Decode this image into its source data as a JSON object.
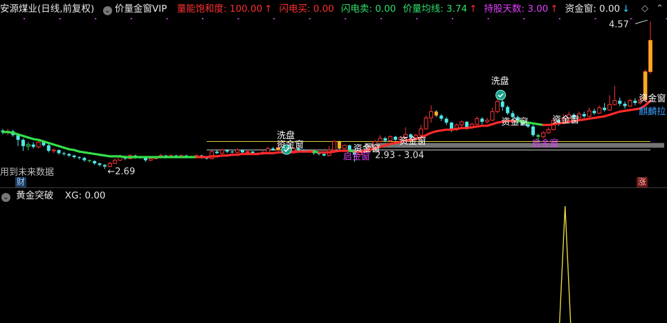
{
  "header": {
    "stock": "安源煤业(日线,前复权)",
    "indicator": "价量金窗VIP",
    "items": [
      {
        "label": "量能饱和度: 100.00",
        "arrow": "↑",
        "color": "#ff3030",
        "arrow_color": "#ff3030"
      },
      {
        "label": "闪电买: 0.00",
        "arrow": "",
        "color": "#ff3030",
        "arrow_color": "#ff3030"
      },
      {
        "label": "闪电卖: 0.00",
        "arrow": "",
        "color": "#2ee06a",
        "arrow_color": "#2ee06a"
      },
      {
        "label": "价量均线: 3.74",
        "arrow": "↑",
        "color": "#2ee06a",
        "arrow_color": "#ff3030"
      },
      {
        "label": "持股天数: 3.00",
        "arrow": "↑",
        "color": "#e040fb",
        "arrow_color": "#ff3030"
      },
      {
        "label": "资金窗: 0.00",
        "arrow": "↓",
        "color": "#e8e8e8",
        "arrow_color": "#39d0ff"
      }
    ],
    "right_icons": [
      "diamond-icon",
      "chevron-up-icon"
    ]
  },
  "sub_header": {
    "indicator": "黄金突破",
    "value": "XG: 0.00"
  },
  "notes": {
    "future_data": "用到未来数据",
    "badge_cai": "财",
    "badge_zhang": "涨"
  },
  "chart_data": [
    {
      "type": "candlestick",
      "annotations": {
        "high_label": "4.57",
        "low_label": "2.69",
        "range_label": "2.93 - 3.04",
        "signals": [
          {
            "text": "洗盘",
            "color": "#ffffff",
            "icon": "shield-check-icon"
          },
          {
            "text": "资金窗",
            "color": "#ffffff"
          },
          {
            "text": "资金窗",
            "color": "#ffffff"
          },
          {
            "text": "启金窗",
            "color": "#e040fb"
          },
          {
            "text": "资金窗",
            "color": "#ffffff"
          },
          {
            "text": "洗盘",
            "color": "#ffffff",
            "icon": "shield-check-icon"
          },
          {
            "text": "资金窗",
            "color": "#ffffff"
          },
          {
            "text": "资金窗",
            "color": "#ffffff"
          },
          {
            "text": "启金窗",
            "color": "#e040fb"
          },
          {
            "text": "资金窗",
            "color": "#ffffff"
          },
          {
            "text": "洗盘",
            "color": "#ffffff"
          },
          {
            "text": "麒麟拉",
            "color": "#39a0ff"
          }
        ]
      },
      "price_range": [
        2.55,
        4.65
      ],
      "candles": [
        [
          3.18,
          3.16,
          3.2,
          3.13
        ],
        [
          3.16,
          3.17,
          3.2,
          3.12
        ],
        [
          3.17,
          3.12,
          3.19,
          3.1
        ],
        [
          3.12,
          3.06,
          3.13,
          2.98
        ],
        [
          3.06,
          2.98,
          3.08,
          2.92
        ],
        [
          2.98,
          3.0,
          3.03,
          2.93
        ],
        [
          3.0,
          2.97,
          3.03,
          2.95
        ],
        [
          2.97,
          3.03,
          3.06,
          2.95
        ],
        [
          3.03,
          2.99,
          3.05,
          2.97
        ],
        [
          2.99,
          2.92,
          3.01,
          2.9
        ],
        [
          2.92,
          2.93,
          2.95,
          2.89
        ],
        [
          2.93,
          2.89,
          2.94,
          2.87
        ],
        [
          2.89,
          2.88,
          2.91,
          2.86
        ],
        [
          2.88,
          2.86,
          2.89,
          2.84
        ],
        [
          2.86,
          2.84,
          2.87,
          2.82
        ],
        [
          2.84,
          2.83,
          2.85,
          2.81
        ],
        [
          2.83,
          2.8,
          2.84,
          2.78
        ],
        [
          2.8,
          2.79,
          2.81,
          2.77
        ],
        [
          2.79,
          2.76,
          2.8,
          2.74
        ],
        [
          2.76,
          2.74,
          2.77,
          2.72
        ],
        [
          2.74,
          2.72,
          2.75,
          2.69
        ],
        [
          2.72,
          2.76,
          2.78,
          2.71
        ],
        [
          2.76,
          2.8,
          2.82,
          2.75
        ],
        [
          2.8,
          2.85,
          2.87,
          2.79
        ],
        [
          2.85,
          2.82,
          2.86,
          2.8
        ],
        [
          2.82,
          2.86,
          2.88,
          2.81
        ],
        [
          2.86,
          2.84,
          2.87,
          2.82
        ],
        [
          2.84,
          2.83,
          2.85,
          2.82
        ],
        [
          2.83,
          2.8,
          2.84,
          2.78
        ],
        [
          2.8,
          2.82,
          2.84,
          2.79
        ],
        [
          2.82,
          2.84,
          2.85,
          2.81
        ],
        [
          2.84,
          2.86,
          2.88,
          2.83
        ],
        [
          2.86,
          2.85,
          2.87,
          2.84
        ],
        [
          2.85,
          2.86,
          2.87,
          2.84
        ],
        [
          2.86,
          2.85,
          2.87,
          2.84
        ],
        [
          2.85,
          2.86,
          2.87,
          2.84
        ],
        [
          2.86,
          2.84,
          2.87,
          2.83
        ],
        [
          2.84,
          2.85,
          2.86,
          2.83
        ],
        [
          2.85,
          2.86,
          2.87,
          2.84
        ],
        [
          2.86,
          2.83,
          2.87,
          2.82
        ],
        [
          2.83,
          2.82,
          2.84,
          2.81
        ],
        [
          2.82,
          2.91,
          2.92,
          2.81
        ],
        [
          2.91,
          2.89,
          2.93,
          2.88
        ],
        [
          2.89,
          2.93,
          2.95,
          2.88
        ],
        [
          2.93,
          2.91,
          2.94,
          2.89
        ],
        [
          2.91,
          2.9,
          2.92,
          2.89
        ],
        [
          2.9,
          2.93,
          2.95,
          2.89
        ],
        [
          2.93,
          2.9,
          2.94,
          2.89
        ],
        [
          2.9,
          2.91,
          2.92,
          2.88
        ],
        [
          2.91,
          2.89,
          2.92,
          2.88
        ],
        [
          2.89,
          2.88,
          2.9,
          2.87
        ],
        [
          2.88,
          2.9,
          2.92,
          2.87
        ],
        [
          2.9,
          2.95,
          2.97,
          2.89
        ],
        [
          2.95,
          2.93,
          2.97,
          2.92
        ],
        [
          2.93,
          2.96,
          3.04,
          2.92
        ],
        [
          2.96,
          2.94,
          2.98,
          2.93
        ],
        [
          2.94,
          2.92,
          2.95,
          2.9
        ],
        [
          2.92,
          2.95,
          2.97,
          2.91
        ],
        [
          2.95,
          2.93,
          2.96,
          2.92
        ],
        [
          2.93,
          2.91,
          2.94,
          2.9
        ],
        [
          2.91,
          2.92,
          2.93,
          2.9
        ],
        [
          2.92,
          2.89,
          2.93,
          2.87
        ],
        [
          2.89,
          2.88,
          2.9,
          2.86
        ],
        [
          2.88,
          2.86,
          2.89,
          2.85
        ],
        [
          2.86,
          2.93,
          2.98,
          2.85
        ],
        [
          2.93,
          3.04,
          3.06,
          2.92
        ],
        [
          3.04,
          2.95,
          3.05,
          2.93
        ],
        [
          2.95,
          2.99,
          3.0,
          2.94
        ],
        [
          2.99,
          2.93,
          3.0,
          2.91
        ],
        [
          2.93,
          2.87,
          2.94,
          2.78
        ],
        [
          2.87,
          2.9,
          2.92,
          2.86
        ],
        [
          2.9,
          2.93,
          2.94,
          2.89
        ],
        [
          2.93,
          2.96,
          2.97,
          2.92
        ],
        [
          2.96,
          3.04,
          3.06,
          2.95
        ],
        [
          3.04,
          3.08,
          3.12,
          3.03
        ],
        [
          3.08,
          3.05,
          3.1,
          3.03
        ],
        [
          3.05,
          3.1,
          3.12,
          3.04
        ],
        [
          3.1,
          3.06,
          3.11,
          3.05
        ],
        [
          3.06,
          3.09,
          3.11,
          3.05
        ],
        [
          3.09,
          3.13,
          3.22,
          3.08
        ],
        [
          3.13,
          3.09,
          3.14,
          3.07
        ],
        [
          3.09,
          3.12,
          3.14,
          3.08
        ],
        [
          3.12,
          3.2,
          3.25,
          3.11
        ],
        [
          3.2,
          3.34,
          3.37,
          3.19
        ],
        [
          3.34,
          3.42,
          3.5,
          3.28
        ],
        [
          3.42,
          3.37,
          3.44,
          3.35
        ],
        [
          3.37,
          3.33,
          3.39,
          3.3
        ],
        [
          3.33,
          3.28,
          3.35,
          3.25
        ],
        [
          3.28,
          3.19,
          3.29,
          3.16
        ],
        [
          3.19,
          3.25,
          3.27,
          3.17
        ],
        [
          3.25,
          3.29,
          3.31,
          3.22
        ],
        [
          3.29,
          3.22,
          3.3,
          3.19
        ],
        [
          3.22,
          3.26,
          3.28,
          3.2
        ],
        [
          3.26,
          3.33,
          3.36,
          3.25
        ],
        [
          3.33,
          3.29,
          3.35,
          3.26
        ],
        [
          3.29,
          3.31,
          3.34,
          3.27
        ],
        [
          3.31,
          3.42,
          3.47,
          3.3
        ],
        [
          3.42,
          3.55,
          3.6,
          3.4
        ],
        [
          3.55,
          3.48,
          3.58,
          3.43
        ],
        [
          3.48,
          3.4,
          3.5,
          3.38
        ],
        [
          3.4,
          3.35,
          3.43,
          3.33
        ],
        [
          3.35,
          3.29,
          3.37,
          3.26
        ],
        [
          3.29,
          3.26,
          3.31,
          3.24
        ],
        [
          3.26,
          3.23,
          3.28,
          3.21
        ],
        [
          3.23,
          3.12,
          3.25,
          3.1
        ],
        [
          3.12,
          3.1,
          3.14,
          3.04
        ],
        [
          3.1,
          3.15,
          3.17,
          3.08
        ],
        [
          3.15,
          3.19,
          3.22,
          3.14
        ],
        [
          3.19,
          3.31,
          3.34,
          3.18
        ],
        [
          3.31,
          3.27,
          3.33,
          3.24
        ],
        [
          3.27,
          3.33,
          3.39,
          3.26
        ],
        [
          3.33,
          3.38,
          3.42,
          3.31
        ],
        [
          3.38,
          3.34,
          3.4,
          3.32
        ],
        [
          3.34,
          3.39,
          3.42,
          3.33
        ],
        [
          3.39,
          3.36,
          3.42,
          3.34
        ],
        [
          3.36,
          3.43,
          3.47,
          3.35
        ],
        [
          3.43,
          3.4,
          3.46,
          3.38
        ],
        [
          3.4,
          3.47,
          3.5,
          3.39
        ],
        [
          3.47,
          3.44,
          3.53,
          3.42
        ],
        [
          3.44,
          3.51,
          3.63,
          3.43
        ],
        [
          3.51,
          3.56,
          3.75,
          3.5
        ],
        [
          3.56,
          3.52,
          3.6,
          3.49
        ],
        [
          3.52,
          3.49,
          3.55,
          3.46
        ],
        [
          3.49,
          3.56,
          3.58,
          3.48
        ],
        [
          3.56,
          3.53,
          3.59,
          3.5
        ],
        [
          3.53,
          3.57,
          3.61,
          3.51
        ],
        [
          3.57,
          3.93,
          3.96,
          3.56
        ],
        [
          3.93,
          4.33,
          4.57,
          3.9
        ]
      ],
      "ma": [
        3.16,
        3.16,
        3.15,
        3.13,
        3.11,
        3.09,
        3.07,
        3.06,
        3.04,
        3.02,
        3.0,
        2.98,
        2.96,
        2.94,
        2.93,
        2.91,
        2.9,
        2.89,
        2.88,
        2.87,
        2.86,
        2.85,
        2.85,
        2.85,
        2.84,
        2.84,
        2.84,
        2.84,
        2.84,
        2.84,
        2.84,
        2.84,
        2.84,
        2.84,
        2.84,
        2.84,
        2.84,
        2.84,
        2.84,
        2.84,
        2.84,
        2.85,
        2.85,
        2.86,
        2.86,
        2.87,
        2.87,
        2.88,
        2.88,
        2.88,
        2.88,
        2.89,
        2.89,
        2.89,
        2.9,
        2.9,
        2.9,
        2.9,
        2.91,
        2.91,
        2.91,
        2.91,
        2.9,
        2.9,
        2.9,
        2.91,
        2.92,
        2.92,
        2.92,
        2.91,
        2.91,
        2.92,
        2.93,
        2.95,
        2.97,
        2.99,
        3.01,
        3.02,
        3.03,
        3.05,
        3.06,
        3.07,
        3.09,
        3.12,
        3.15,
        3.17,
        3.18,
        3.19,
        3.19,
        3.2,
        3.21,
        3.21,
        3.22,
        3.23,
        3.24,
        3.24,
        3.26,
        3.28,
        3.29,
        3.3,
        3.3,
        3.3,
        3.29,
        3.28,
        3.27,
        3.26,
        3.25,
        3.25,
        3.26,
        3.27,
        3.28,
        3.29,
        3.3,
        3.31,
        3.32,
        3.33,
        3.34,
        3.35,
        3.36,
        3.38,
        3.4,
        3.42,
        3.43,
        3.44,
        3.45,
        3.46,
        3.5,
        3.56
      ],
      "ma_colors": {
        "up": "#ff2a2a",
        "down": "#33e04a"
      },
      "reference_lines": [
        3.04,
        2.93
      ]
    },
    {
      "type": "line",
      "series": [
        {
          "name": "XG",
          "spike_index": 110,
          "value": 1
        }
      ],
      "ylim": [
        0,
        1
      ],
      "color": "#e8d93a"
    }
  ]
}
